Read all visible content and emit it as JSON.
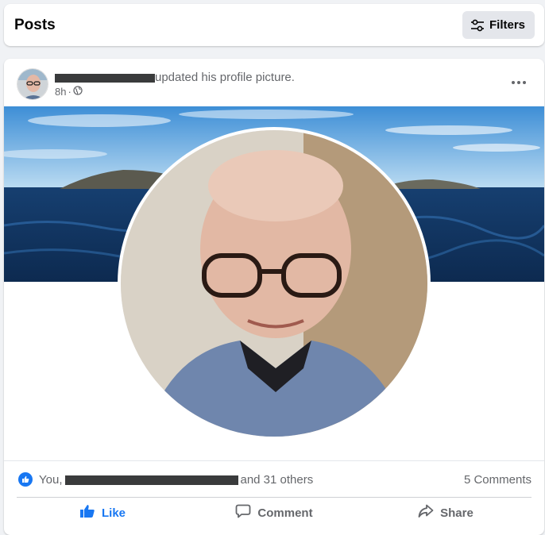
{
  "header": {
    "title": "Posts",
    "filters_label": "Filters",
    "filters_icon": "sliders-icon"
  },
  "post": {
    "author_name": "[redacted]",
    "action_text": "updated his profile picture.",
    "timestamp": "8h",
    "audience_icon": "globe-icon",
    "more_icon": "more-horizontal-icon",
    "cover_image": "sea-and-islands-cover-photo",
    "profile_image": "man-with-glasses-profile-photo"
  },
  "reactions": {
    "prefix": "You,",
    "names": "[redacted]",
    "suffix": "and 31 others",
    "comments": "5 Comments"
  },
  "actions": {
    "like_label": "Like",
    "comment_label": "Comment",
    "share_label": "Share"
  },
  "colors": {
    "accent": "#1877f2",
    "secondary_text": "#65676b",
    "background": "#f0f2f5",
    "card": "#ffffff"
  }
}
